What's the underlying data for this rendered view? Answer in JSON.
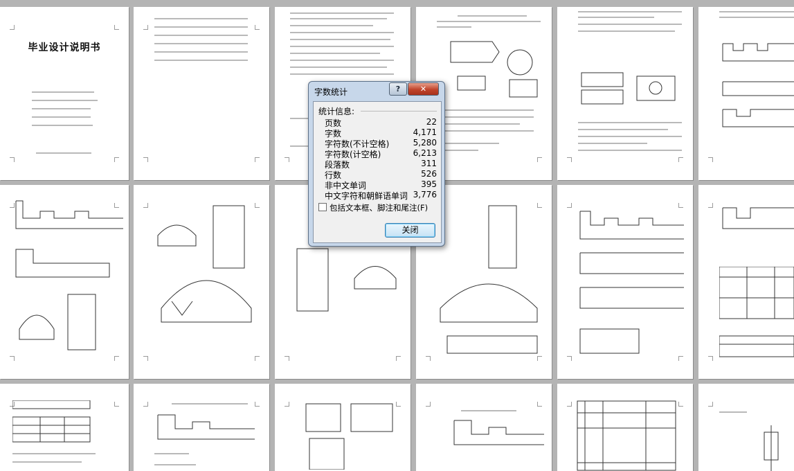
{
  "document": {
    "cover_title": "毕业设计说明书"
  },
  "dialog": {
    "title": "字数统计",
    "help_label": "?",
    "close_label": "✕",
    "section_heading": "统计信息:",
    "stats": [
      {
        "label": "页数",
        "value": "22"
      },
      {
        "label": "字数",
        "value": "4,171"
      },
      {
        "label": "字符数(不计空格)",
        "value": "5,280"
      },
      {
        "label": "字符数(计空格)",
        "value": "6,213"
      },
      {
        "label": "段落数",
        "value": "311"
      },
      {
        "label": "行数",
        "value": "526"
      },
      {
        "label": "非中文单词",
        "value": "395"
      },
      {
        "label": "中文字符和朝鲜语单词",
        "value": "3,776"
      }
    ],
    "include_checkbox_label": "包括文本框、脚注和尾注(F)",
    "include_checked": false,
    "close_button_label": "关闭"
  },
  "colors": {
    "workspace": "#b4b4b4",
    "page": "#ffffff",
    "dialog_frame": "#c7d7ea",
    "close_button": "#c0442b"
  }
}
